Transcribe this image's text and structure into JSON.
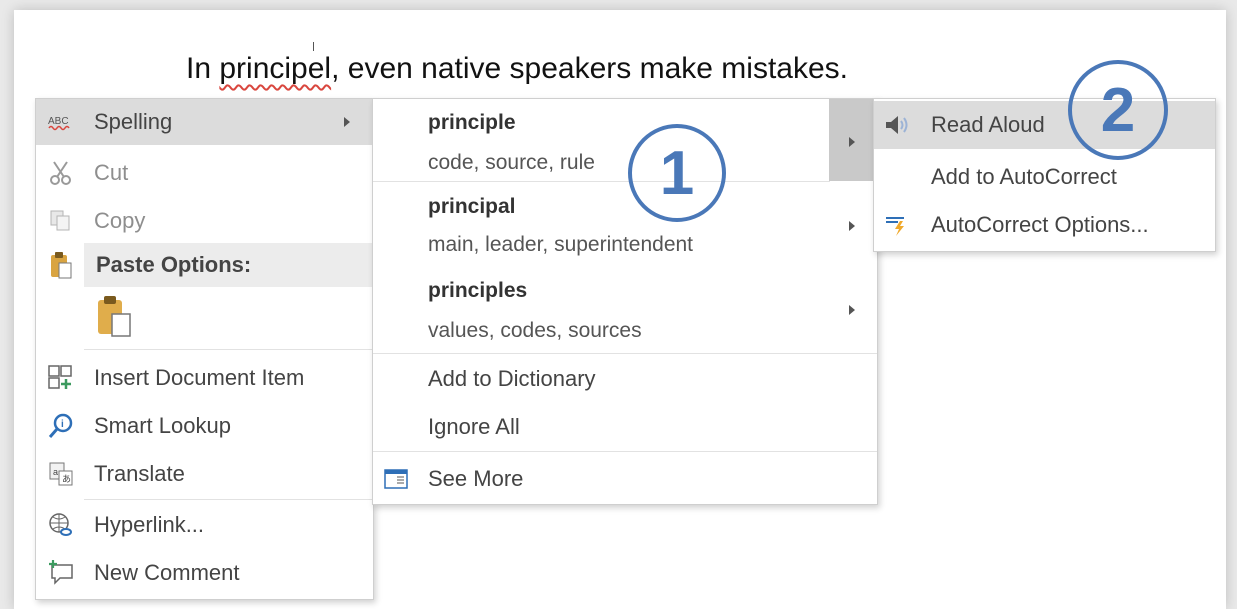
{
  "document": {
    "before": "In ",
    "misspelled": "principel",
    "after": ", even native speakers make mistakes."
  },
  "context_menu": {
    "spelling": "Spelling",
    "cut": "Cut",
    "copy": "Copy",
    "paste_options": "Paste Options:",
    "insert_document_item": "Insert Document Item",
    "smart_lookup": "Smart Lookup",
    "translate": "Translate",
    "hyperlink": "Hyperlink...",
    "new_comment": "New Comment"
  },
  "spelling_menu": {
    "suggestions": [
      {
        "word": "principle",
        "synonyms": "code, source, rule"
      },
      {
        "word": "principal",
        "synonyms": "main, leader, superintendent"
      },
      {
        "word": "principles",
        "synonyms": "values, codes, sources"
      }
    ],
    "add_to_dictionary": "Add to Dictionary",
    "ignore_all": "Ignore All",
    "see_more": "See More"
  },
  "suggestion_menu": {
    "read_aloud": "Read Aloud",
    "add_to_autocorrect": "Add to AutoCorrect",
    "autocorrect_options": "AutoCorrect Options..."
  },
  "callouts": {
    "one": "1",
    "two": "2"
  },
  "colors": {
    "callout": "#4a78b8",
    "highlight": "#dcdcdc",
    "squiggle": "#d9463e"
  }
}
